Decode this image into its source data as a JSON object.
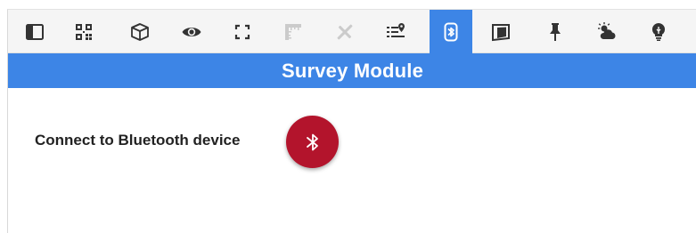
{
  "toolbar": {
    "tools": [
      {
        "icon": "sidebar-icon"
      },
      {
        "icon": "qr-code-icon"
      },
      {
        "icon": "cube-icon"
      },
      {
        "icon": "eye-icon"
      },
      {
        "icon": "fullscreen-icon"
      },
      {
        "icon": "ruler-icon",
        "state": "disabled"
      },
      {
        "icon": "measure-tools-icon",
        "state": "disabled"
      },
      {
        "icon": "map-list-icon"
      },
      {
        "icon": "bluetooth-device-icon",
        "state": "active"
      },
      {
        "icon": "panel-3d-icon"
      },
      {
        "icon": "pin-icon"
      },
      {
        "icon": "weather-icon"
      },
      {
        "icon": "lightbulb-icon"
      }
    ]
  },
  "module": {
    "title": "Survey Module"
  },
  "connect": {
    "label": "Connect to Bluetooth device",
    "button_icon": "bluetooth-icon"
  },
  "colors": {
    "accent_blue": "#3d85e6",
    "button_red": "#b3142c",
    "toolbar_bg": "#f5f5f5",
    "icon_dark": "#333333"
  }
}
